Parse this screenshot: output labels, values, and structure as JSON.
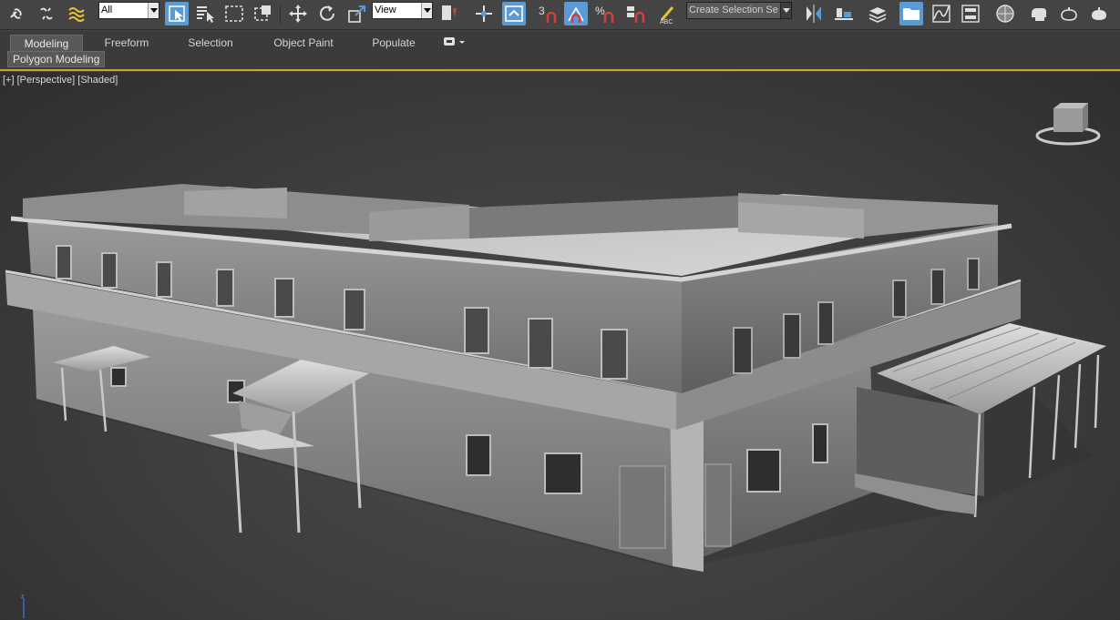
{
  "toolbar": {
    "selection_filter": "All",
    "reference_coord": "View",
    "named_selection_set": "Create Selection Se",
    "icons": [
      "link-icon",
      "unlink-icon",
      "bind-space-warp-icon",
      "select-object-icon",
      "select-by-name-icon",
      "rectangle-selection-icon",
      "window-crossing-icon",
      "move-icon",
      "rotate-icon",
      "scale-icon",
      "select-manipulate-icon",
      "use-pivot-center-icon",
      "snap-3d-icon",
      "angle-snap-icon",
      "percent-snap-icon",
      "spinner-snap-icon",
      "edit-named-selections-icon",
      "mirror-icon",
      "align-icon",
      "toggle-scene-explorer-icon",
      "toggle-layer-explorer-icon",
      "toggle-ribbon-icon",
      "curve-editor-icon",
      "schematic-view-icon",
      "material-editor-icon",
      "render-setup-icon",
      "rendered-frame-icon",
      "render-production-icon"
    ],
    "active_color": "#5b9bd5"
  },
  "ribbon": {
    "tabs": [
      "Modeling",
      "Freeform",
      "Selection",
      "Object Paint",
      "Populate"
    ],
    "active_tab": "Modeling",
    "panel": "Polygon Modeling",
    "accent": "#c7a72b"
  },
  "viewport": {
    "menu_plus": "[+]",
    "menu_view": "[Perspective]",
    "menu_shading": "[Shaded]",
    "axis_label": "z",
    "model": "weathered two-storey corner building"
  }
}
